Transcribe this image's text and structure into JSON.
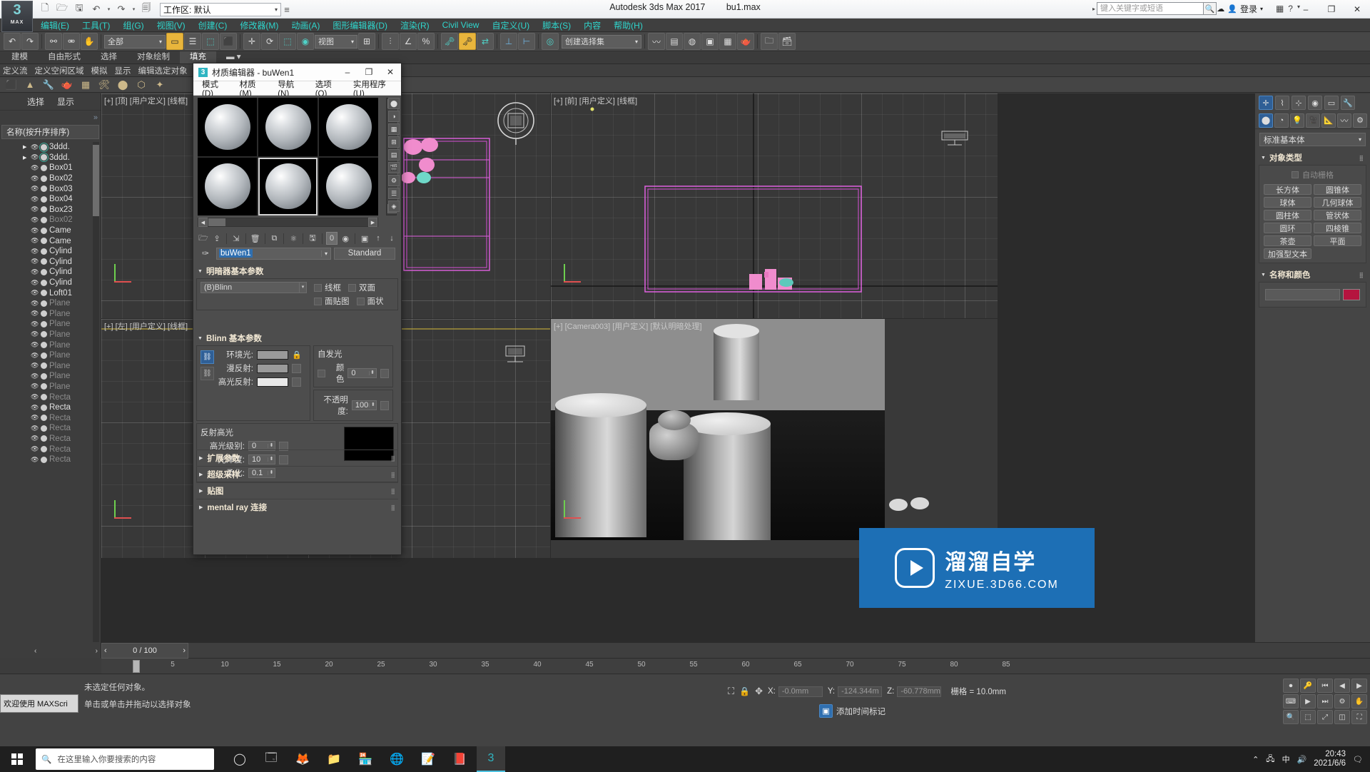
{
  "titlebar": {
    "app_title": "Autodesk 3ds Max 2017",
    "file_name": "bu1.max",
    "workspace_label": "工作区: 默认",
    "search_placeholder": "键入关键字或短语",
    "signin_label": "登录",
    "min_label": "–",
    "max_label": "❐",
    "close_label": "✕",
    "quick_icons": [
      "new-icon",
      "open-icon",
      "save-icon",
      "undo-icon",
      "redo-icon",
      "set-icon"
    ]
  },
  "menubar": {
    "items": [
      "编辑(E)",
      "工具(T)",
      "组(G)",
      "视图(V)",
      "创建(C)",
      "修改器(M)",
      "动画(A)",
      "图形编辑器(D)",
      "渲染(R)",
      "Civil View",
      "自定义(U)",
      "脚本(S)",
      "内容",
      "帮助(H)"
    ]
  },
  "toolbar": {
    "selection_filter": "全部",
    "view_combo": "视图",
    "selection_set": "创建选择集"
  },
  "ribbon": {
    "tabs": [
      "建模",
      "自由形式",
      "选择",
      "对象绘制",
      "填充"
    ],
    "row2": [
      "定义流",
      "定义空闲区域",
      "模拟",
      "显示",
      "编辑选定对象"
    ]
  },
  "scene_explorer": {
    "tabs": [
      "选择",
      "显示"
    ],
    "column_header": "名称(按升序排序)",
    "rows": [
      {
        "name": "3ddd.",
        "expandable": true,
        "dim": false
      },
      {
        "name": "3ddd.",
        "expandable": true,
        "dim": false
      },
      {
        "name": "Box01",
        "expandable": false,
        "dim": false
      },
      {
        "name": "Box02",
        "expandable": false,
        "dim": false
      },
      {
        "name": "Box03",
        "expandable": false,
        "dim": false
      },
      {
        "name": "Box04",
        "expandable": false,
        "dim": false
      },
      {
        "name": "Box23",
        "expandable": false,
        "dim": false
      },
      {
        "name": "Box02",
        "expandable": false,
        "dim": true
      },
      {
        "name": "Came",
        "expandable": false,
        "dim": false
      },
      {
        "name": "Came",
        "expandable": false,
        "dim": false
      },
      {
        "name": "Cylind",
        "expandable": false,
        "dim": false
      },
      {
        "name": "Cylind",
        "expandable": false,
        "dim": false
      },
      {
        "name": "Cylind",
        "expandable": false,
        "dim": false
      },
      {
        "name": "Cylind",
        "expandable": false,
        "dim": false
      },
      {
        "name": "Loft01",
        "expandable": false,
        "dim": false
      },
      {
        "name": "Plane",
        "expandable": false,
        "dim": true
      },
      {
        "name": "Plane",
        "expandable": false,
        "dim": true
      },
      {
        "name": "Plane",
        "expandable": false,
        "dim": true
      },
      {
        "name": "Plane",
        "expandable": false,
        "dim": true
      },
      {
        "name": "Plane",
        "expandable": false,
        "dim": true
      },
      {
        "name": "Plane",
        "expandable": false,
        "dim": true
      },
      {
        "name": "Plane",
        "expandable": false,
        "dim": true
      },
      {
        "name": "Plane",
        "expandable": false,
        "dim": true
      },
      {
        "name": "Plane",
        "expandable": false,
        "dim": true
      },
      {
        "name": "Recta",
        "expandable": false,
        "dim": true
      },
      {
        "name": "Recta",
        "expandable": false,
        "dim": false
      },
      {
        "name": "Recta",
        "expandable": false,
        "dim": true
      },
      {
        "name": "Recta",
        "expandable": false,
        "dim": true
      },
      {
        "name": "Recta",
        "expandable": false,
        "dim": true
      },
      {
        "name": "Recta",
        "expandable": false,
        "dim": true
      },
      {
        "name": "Recta",
        "expandable": false,
        "dim": true
      }
    ],
    "footer_left": "‹",
    "footer_right": "›"
  },
  "viewports": [
    {
      "label": "[+] [顶] [用户定义] [线框]",
      "name": "viewport-top"
    },
    {
      "label": "[+] [前] [用户定义] [线框]",
      "name": "viewport-front"
    },
    {
      "label": "[+] [左] [用户定义] [线框]",
      "name": "viewport-left"
    },
    {
      "label": "[+] [Camera003] [用户定义] [默认明暗处理]",
      "name": "viewport-camera",
      "selected": true
    }
  ],
  "command_panel": {
    "category_dropdown": "标准基本体",
    "object_type": {
      "title": "对象类型",
      "autogrid_label": "自动栅格",
      "buttons": [
        "长方体",
        "圆锥体",
        "球体",
        "几何球体",
        "圆柱体",
        "管状体",
        "圆环",
        "四棱锥",
        "茶壶",
        "平面",
        "加强型文本"
      ]
    },
    "name_color": {
      "title": "名称和颜色",
      "name_value": "",
      "color_hex": "#b5143f"
    }
  },
  "material_editor": {
    "title": "材质编辑器 - buWen1",
    "icon_badge": "3",
    "menu": [
      "模式(D)",
      "材质(M)",
      "导航(N)",
      "选项(O)",
      "实用程序(U)"
    ],
    "window_buttons": {
      "min": "–",
      "max": "❐",
      "close": "✕"
    },
    "active_slot_index": 4,
    "slot_count": 6,
    "material_name": "buWen1",
    "material_type_button": "Standard",
    "counter_value": "0",
    "shader_rollout": {
      "title": "明暗器基本参数",
      "shader": "(B)Blinn",
      "checks": [
        {
          "label": "线框",
          "checked": false
        },
        {
          "label": "双面",
          "checked": false
        },
        {
          "label": "面贴图",
          "checked": false
        },
        {
          "label": "面状",
          "checked": false
        }
      ]
    },
    "blinn_rollout": {
      "title": "Blinn 基本参数",
      "colors": [
        {
          "label": "环境光:",
          "hex": "#9a9a9a"
        },
        {
          "label": "漫反射:",
          "hex": "#9a9a9a"
        },
        {
          "label": "高光反射:",
          "hex": "#e8e8e8"
        }
      ],
      "self_illum": {
        "title": "自发光",
        "color_label": "颜色",
        "color_checked": false,
        "value": "0"
      },
      "opacity": {
        "label": "不透明度:",
        "value": "100"
      },
      "specular_group": {
        "title": "反射高光",
        "fields": [
          {
            "label": "高光级别:",
            "value": "0"
          },
          {
            "label": "光泽度:",
            "value": "10"
          },
          {
            "label": "柔化:",
            "value": "0.1"
          }
        ],
        "curve_bg": "#000000"
      }
    },
    "rollouts": [
      "扩展参数",
      "超级采样",
      "贴图",
      "mental ray 连接"
    ]
  },
  "timeline": {
    "range_label": "0 / 100",
    "ticks": [
      "5",
      "10",
      "15",
      "20",
      "25",
      "30",
      "35",
      "40",
      "45",
      "50",
      "55",
      "60",
      "65",
      "70",
      "75",
      "80",
      "85"
    ]
  },
  "statusbar": {
    "maxscript_label": "欢迎使用 MAXScri",
    "line1": "未选定任何对象。",
    "line2": "单击或单击并拖动以选择对象",
    "coords": [
      {
        "axis": "X:",
        "value": "-0.0mm"
      },
      {
        "axis": "Y:",
        "value": "-124.344m"
      },
      {
        "axis": "Z:",
        "value": "-60.778mm"
      }
    ],
    "grid_label": "栅格 = 10.0mm",
    "add_key_label": "添加时间标记"
  },
  "taskbar": {
    "search_placeholder": "在这里输入你要搜索的内容",
    "clock_time": "20:43",
    "clock_date": "2021/6/6",
    "tray_lang": "中",
    "app_icons": [
      "cortana-icon",
      "taskview-icon",
      "firefox-icon",
      "folder-icon",
      "store-icon",
      "edge-icon",
      "notes-icon",
      "pdf-icon",
      "max-icon"
    ]
  },
  "watermark": {
    "line1": "溜溜自学",
    "line2": "ZIXUE.3D66.COM"
  }
}
